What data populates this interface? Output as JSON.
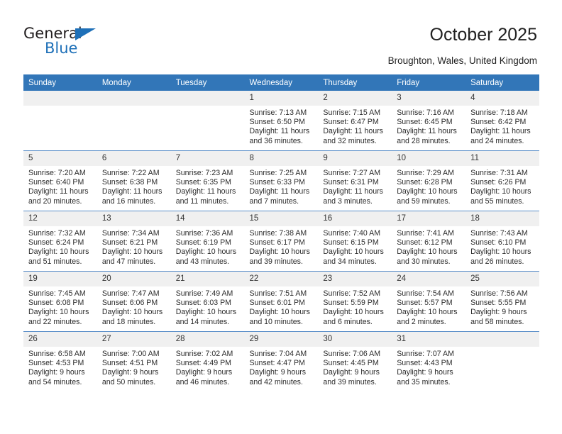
{
  "brand": {
    "name_part1": "General",
    "name_part2": "Blue",
    "triangle_color": "#1e70b8",
    "text_color": "#231f20"
  },
  "header": {
    "title": "October 2025",
    "location": "Broughton, Wales, United Kingdom",
    "header_bg": "#3276b8",
    "daynum_bg": "#f0f0f0"
  },
  "weekday_headers": [
    "Sunday",
    "Monday",
    "Tuesday",
    "Wednesday",
    "Thursday",
    "Friday",
    "Saturday"
  ],
  "weeks": [
    [
      {
        "day": "",
        "empty": true,
        "lines": []
      },
      {
        "day": "",
        "empty": true,
        "lines": []
      },
      {
        "day": "",
        "empty": true,
        "lines": []
      },
      {
        "day": "1",
        "empty": false,
        "lines": [
          "Sunrise: 7:13 AM",
          "Sunset: 6:50 PM",
          "Daylight: 11 hours",
          "and 36 minutes."
        ]
      },
      {
        "day": "2",
        "empty": false,
        "lines": [
          "Sunrise: 7:15 AM",
          "Sunset: 6:47 PM",
          "Daylight: 11 hours",
          "and 32 minutes."
        ]
      },
      {
        "day": "3",
        "empty": false,
        "lines": [
          "Sunrise: 7:16 AM",
          "Sunset: 6:45 PM",
          "Daylight: 11 hours",
          "and 28 minutes."
        ]
      },
      {
        "day": "4",
        "empty": false,
        "lines": [
          "Sunrise: 7:18 AM",
          "Sunset: 6:42 PM",
          "Daylight: 11 hours",
          "and 24 minutes."
        ]
      }
    ],
    [
      {
        "day": "5",
        "empty": false,
        "lines": [
          "Sunrise: 7:20 AM",
          "Sunset: 6:40 PM",
          "Daylight: 11 hours",
          "and 20 minutes."
        ]
      },
      {
        "day": "6",
        "empty": false,
        "lines": [
          "Sunrise: 7:22 AM",
          "Sunset: 6:38 PM",
          "Daylight: 11 hours",
          "and 16 minutes."
        ]
      },
      {
        "day": "7",
        "empty": false,
        "lines": [
          "Sunrise: 7:23 AM",
          "Sunset: 6:35 PM",
          "Daylight: 11 hours",
          "and 11 minutes."
        ]
      },
      {
        "day": "8",
        "empty": false,
        "lines": [
          "Sunrise: 7:25 AM",
          "Sunset: 6:33 PM",
          "Daylight: 11 hours",
          "and 7 minutes."
        ]
      },
      {
        "day": "9",
        "empty": false,
        "lines": [
          "Sunrise: 7:27 AM",
          "Sunset: 6:31 PM",
          "Daylight: 11 hours",
          "and 3 minutes."
        ]
      },
      {
        "day": "10",
        "empty": false,
        "lines": [
          "Sunrise: 7:29 AM",
          "Sunset: 6:28 PM",
          "Daylight: 10 hours",
          "and 59 minutes."
        ]
      },
      {
        "day": "11",
        "empty": false,
        "lines": [
          "Sunrise: 7:31 AM",
          "Sunset: 6:26 PM",
          "Daylight: 10 hours",
          "and 55 minutes."
        ]
      }
    ],
    [
      {
        "day": "12",
        "empty": false,
        "lines": [
          "Sunrise: 7:32 AM",
          "Sunset: 6:24 PM",
          "Daylight: 10 hours",
          "and 51 minutes."
        ]
      },
      {
        "day": "13",
        "empty": false,
        "lines": [
          "Sunrise: 7:34 AM",
          "Sunset: 6:21 PM",
          "Daylight: 10 hours",
          "and 47 minutes."
        ]
      },
      {
        "day": "14",
        "empty": false,
        "lines": [
          "Sunrise: 7:36 AM",
          "Sunset: 6:19 PM",
          "Daylight: 10 hours",
          "and 43 minutes."
        ]
      },
      {
        "day": "15",
        "empty": false,
        "lines": [
          "Sunrise: 7:38 AM",
          "Sunset: 6:17 PM",
          "Daylight: 10 hours",
          "and 39 minutes."
        ]
      },
      {
        "day": "16",
        "empty": false,
        "lines": [
          "Sunrise: 7:40 AM",
          "Sunset: 6:15 PM",
          "Daylight: 10 hours",
          "and 34 minutes."
        ]
      },
      {
        "day": "17",
        "empty": false,
        "lines": [
          "Sunrise: 7:41 AM",
          "Sunset: 6:12 PM",
          "Daylight: 10 hours",
          "and 30 minutes."
        ]
      },
      {
        "day": "18",
        "empty": false,
        "lines": [
          "Sunrise: 7:43 AM",
          "Sunset: 6:10 PM",
          "Daylight: 10 hours",
          "and 26 minutes."
        ]
      }
    ],
    [
      {
        "day": "19",
        "empty": false,
        "lines": [
          "Sunrise: 7:45 AM",
          "Sunset: 6:08 PM",
          "Daylight: 10 hours",
          "and 22 minutes."
        ]
      },
      {
        "day": "20",
        "empty": false,
        "lines": [
          "Sunrise: 7:47 AM",
          "Sunset: 6:06 PM",
          "Daylight: 10 hours",
          "and 18 minutes."
        ]
      },
      {
        "day": "21",
        "empty": false,
        "lines": [
          "Sunrise: 7:49 AM",
          "Sunset: 6:03 PM",
          "Daylight: 10 hours",
          "and 14 minutes."
        ]
      },
      {
        "day": "22",
        "empty": false,
        "lines": [
          "Sunrise: 7:51 AM",
          "Sunset: 6:01 PM",
          "Daylight: 10 hours",
          "and 10 minutes."
        ]
      },
      {
        "day": "23",
        "empty": false,
        "lines": [
          "Sunrise: 7:52 AM",
          "Sunset: 5:59 PM",
          "Daylight: 10 hours",
          "and 6 minutes."
        ]
      },
      {
        "day": "24",
        "empty": false,
        "lines": [
          "Sunrise: 7:54 AM",
          "Sunset: 5:57 PM",
          "Daylight: 10 hours",
          "and 2 minutes."
        ]
      },
      {
        "day": "25",
        "empty": false,
        "lines": [
          "Sunrise: 7:56 AM",
          "Sunset: 5:55 PM",
          "Daylight: 9 hours",
          "and 58 minutes."
        ]
      }
    ],
    [
      {
        "day": "26",
        "empty": false,
        "lines": [
          "Sunrise: 6:58 AM",
          "Sunset: 4:53 PM",
          "Daylight: 9 hours",
          "and 54 minutes."
        ]
      },
      {
        "day": "27",
        "empty": false,
        "lines": [
          "Sunrise: 7:00 AM",
          "Sunset: 4:51 PM",
          "Daylight: 9 hours",
          "and 50 minutes."
        ]
      },
      {
        "day": "28",
        "empty": false,
        "lines": [
          "Sunrise: 7:02 AM",
          "Sunset: 4:49 PM",
          "Daylight: 9 hours",
          "and 46 minutes."
        ]
      },
      {
        "day": "29",
        "empty": false,
        "lines": [
          "Sunrise: 7:04 AM",
          "Sunset: 4:47 PM",
          "Daylight: 9 hours",
          "and 42 minutes."
        ]
      },
      {
        "day": "30",
        "empty": false,
        "lines": [
          "Sunrise: 7:06 AM",
          "Sunset: 4:45 PM",
          "Daylight: 9 hours",
          "and 39 minutes."
        ]
      },
      {
        "day": "31",
        "empty": false,
        "lines": [
          "Sunrise: 7:07 AM",
          "Sunset: 4:43 PM",
          "Daylight: 9 hours",
          "and 35 minutes."
        ]
      },
      {
        "day": "",
        "empty": true,
        "lines": []
      }
    ]
  ]
}
